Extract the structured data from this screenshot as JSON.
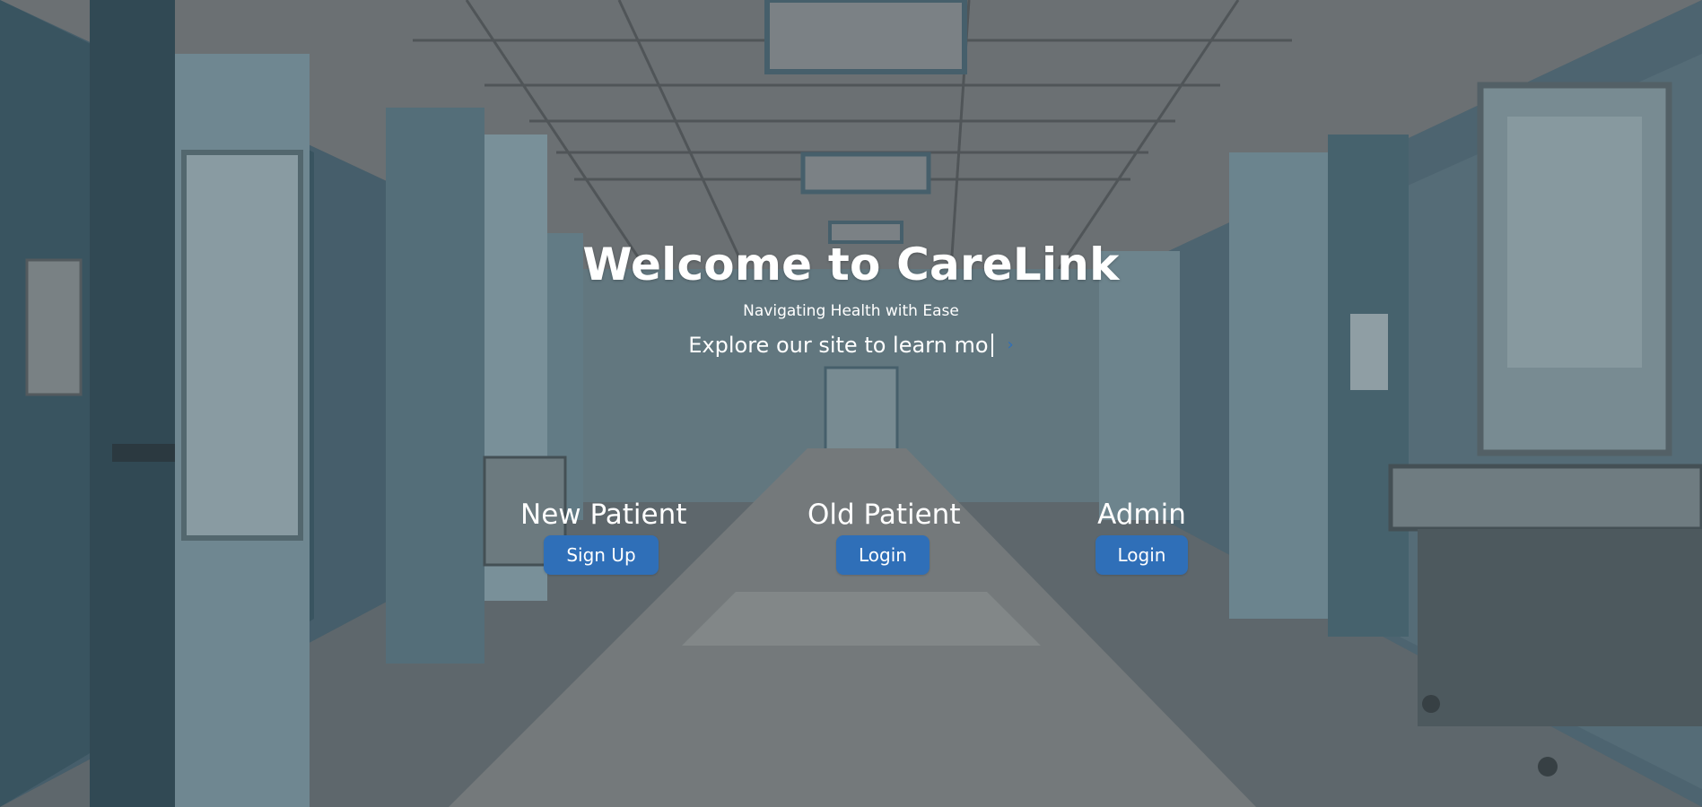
{
  "hero": {
    "title": "Welcome to CareLink",
    "subtitle": "Navigating Health with Ease",
    "typed_text": "Explore our site to learn mo",
    "arrow_icon": "arrow-right-icon"
  },
  "roles": [
    {
      "title": "New Patient",
      "button_label": "Sign Up"
    },
    {
      "title": "Old Patient",
      "button_label": "Login"
    },
    {
      "title": "Admin",
      "button_label": "Login"
    }
  ],
  "colors": {
    "accent": "#2f6fb8",
    "text": "#ffffff",
    "background_tint": "#5f6e74"
  }
}
